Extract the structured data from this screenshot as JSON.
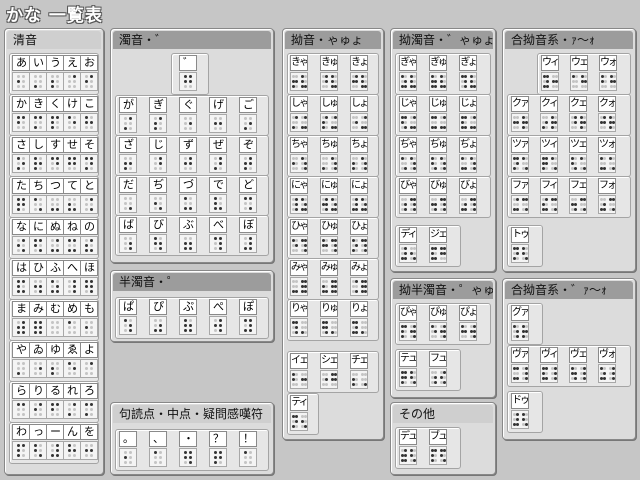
{
  "title": "かな 一覧表",
  "sections": {
    "seion": {
      "title": "清音",
      "rows": [
        [
          "あ",
          "い",
          "う",
          "え",
          "お"
        ],
        [
          "か",
          "き",
          "く",
          "け",
          "こ"
        ],
        [
          "さ",
          "し",
          "す",
          "せ",
          "そ"
        ],
        [
          "た",
          "ち",
          "つ",
          "て",
          "と"
        ],
        [
          "な",
          "に",
          "ぬ",
          "ね",
          "の"
        ],
        [
          "は",
          "ひ",
          "ふ",
          "へ",
          "ほ"
        ],
        [
          "ま",
          "み",
          "む",
          "め",
          "も"
        ],
        [
          "や",
          "ゐ",
          "ゆ",
          "ゑ",
          "よ"
        ],
        [
          "ら",
          "り",
          "る",
          "れ",
          "ろ"
        ],
        [
          "わ",
          "っ",
          "ー",
          "ん",
          "を"
        ]
      ]
    },
    "dakuon": {
      "title": "濁音・゛",
      "marker": "゛",
      "rows": [
        [
          "が",
          "ぎ",
          "ぐ",
          "げ",
          "ご"
        ],
        [
          "ざ",
          "じ",
          "ず",
          "ぜ",
          "ぞ"
        ],
        [
          "だ",
          "ぢ",
          "づ",
          "で",
          "ど"
        ],
        [
          "ば",
          "び",
          "ぶ",
          "べ",
          "ぼ"
        ]
      ]
    },
    "handakuon": {
      "title": "半濁音・゜",
      "rows": [
        [
          "ぱ",
          "ぴ",
          "ぷ",
          "ぺ",
          "ぽ"
        ]
      ]
    },
    "kutoten": {
      "title": "句読点・中点・疑問感嘆符",
      "rows": [
        [
          "。",
          "、",
          "・",
          "？",
          "！"
        ]
      ]
    },
    "yoon": {
      "title": "拗音・ゃゅょ",
      "rows": [
        [
          "きゃ",
          "きゅ",
          "きょ"
        ],
        [
          "しゃ",
          "しゅ",
          "しょ"
        ],
        [
          "ちゃ",
          "ちゅ",
          "ちょ"
        ],
        [
          "にゃ",
          "にゅ",
          "にょ"
        ],
        [
          "ひゃ",
          "ひゅ",
          "ひょ"
        ],
        [
          "みゃ",
          "みゅ",
          "みょ"
        ],
        [
          "りゃ",
          "りゅ",
          "りょ"
        ]
      ],
      "extra1": [
        "イェ",
        "シェ",
        "チェ"
      ],
      "extra2": [
        "ティ"
      ]
    },
    "yodakuon": {
      "title": "拗濁音・゛ゃゅょ",
      "rows": [
        [
          "ぎゃ",
          "ぎゅ",
          "ぎょ"
        ],
        [
          "じゃ",
          "じゅ",
          "じょ"
        ],
        [
          "ぢゃ",
          "ぢゅ",
          "ぢょ"
        ],
        [
          "びゃ",
          "びゅ",
          "びょ"
        ]
      ],
      "extra": [
        "ディ",
        "ジェ"
      ]
    },
    "yohandakuon": {
      "title": "拗半濁音・゜ゃゅょ",
      "rows": [
        [
          "ぴゃ",
          "ぴゅ",
          "ぴょ"
        ]
      ],
      "extra": [
        "テュ",
        "フュ"
      ]
    },
    "sonota": {
      "title": "その他",
      "rows": [
        [
          "デュ",
          "ブュ"
        ]
      ]
    },
    "goyoon": {
      "title": "合拗音系・ｧ〜ｫ",
      "rows": [
        [
          "ウィ",
          "ウェ",
          "ウォ"
        ],
        [
          "クァ",
          "クィ",
          "クェ",
          "クォ"
        ],
        [
          "ツァ",
          "ツィ",
          "ツェ",
          "ツォ"
        ],
        [
          "ファ",
          "フィ",
          "フェ",
          "フォ"
        ]
      ],
      "extra": [
        "トゥ"
      ]
    },
    "godakuyoon": {
      "title": "合拗音系・゛ｧ〜ｫ",
      "rows": [
        [
          "グァ"
        ],
        [
          "ヴァ",
          "ヴィ",
          "ヴェ",
          "ヴォ"
        ]
      ],
      "extra": [
        "ドゥ"
      ]
    }
  }
}
